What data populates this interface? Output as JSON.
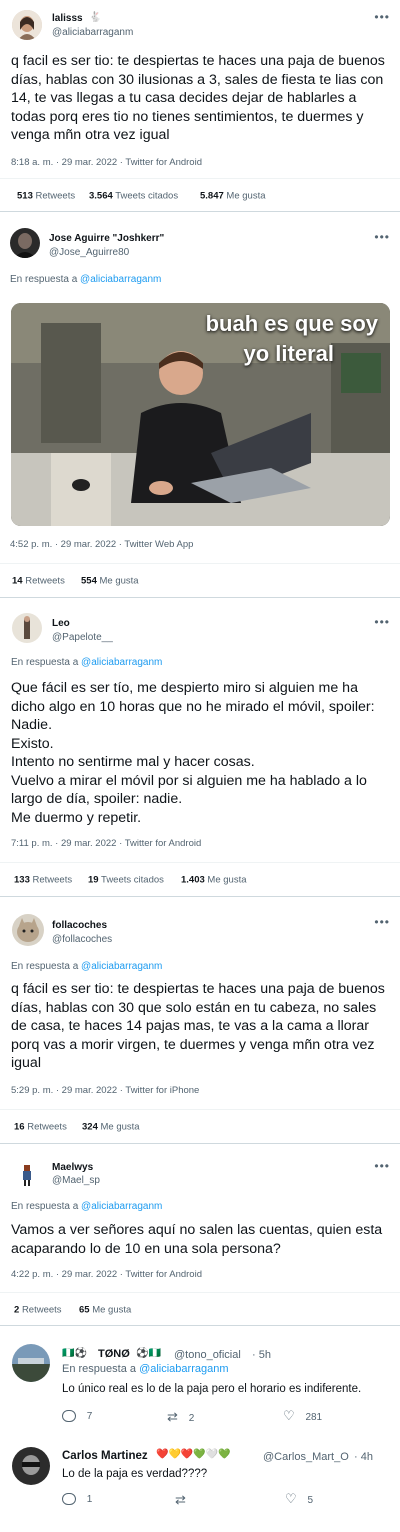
{
  "tweets": [
    {
      "name": "lalisss",
      "handle": "@aliciabarraganm",
      "text": "q facil es ser tio: te despiertas te haces una paja de buenos días, hablas con 30 ilusionas a 3, sales de fiesta te lias con 14, te vas llegas a tu casa decides dejar de hablarles a todas porq eres tio no tienes sentimientos, te duermes y venga mñn otra vez igual",
      "meta": "8:18 a. m. · 29 mar. 2022 · Twitter for Android",
      "retweets": "513",
      "retweets_label": "Retweets",
      "quotes": "3.564",
      "quotes_label": "Tweets citados",
      "likes": "5.847",
      "likes_label": "Me gusta"
    },
    {
      "name": "Jose Aguirre \"Joshkerr\"",
      "handle": "@Jose_Aguirre80",
      "reply_prefix": "En respuesta a",
      "reply_to": "@aliciabarraganm",
      "image_caption_1": "buah es que soy",
      "image_caption_2": "yo literal",
      "meta": "4:52 p. m. · 29 mar. 2022 · Twitter Web App",
      "retweets": "14",
      "retweets_label": "Retweets",
      "likes": "554",
      "likes_label": "Me gusta"
    },
    {
      "name": "Leo",
      "handle": "@Papelote__",
      "reply_prefix": "En respuesta a",
      "reply_to": "@aliciabarraganm",
      "text": "Que fácil es ser tío, me despierto miro si alguien me ha dicho algo en 10 horas que no he mirado el móvil, spoiler: Nadie.\nExisto.\nIntento no sentirme mal y hacer cosas.\nVuelvo a mirar el móvil por si alguien me ha hablado a lo largo de día, spoiler: nadie.\nMe duermo y repetir.",
      "meta": "7:11 p. m. · 29 mar. 2022 · Twitter for Android",
      "retweets": "133",
      "retweets_label": "Retweets",
      "quotes": "19",
      "quotes_label": "Tweets citados",
      "likes": "1.403",
      "likes_label": "Me gusta"
    },
    {
      "name": "follacoches",
      "handle": "@follacoches",
      "reply_prefix": "En respuesta a",
      "reply_to": "@aliciabarraganm",
      "text": "q fácil es ser tio: te despiertas te haces una paja de buenos días, hablas con 30 que solo están en tu cabeza, no sales de casa, te haces 14 pajas mas, te vas a la cama a llorar porq vas a morir virgen, te duermes y venga mñn otra vez igual",
      "meta": "5:29 p. m. · 29 mar. 2022 · Twitter for iPhone",
      "retweets": "16",
      "retweets_label": "Retweets",
      "likes": "324",
      "likes_label": "Me gusta"
    },
    {
      "name": "Maelwys",
      "handle": "@Mael_sp",
      "reply_prefix": "En respuesta a",
      "reply_to": "@aliciabarraganm",
      "text": "Vamos a ver señores aquí no salen las cuentas, quien esta acaparando lo de 10 en una sola persona?",
      "meta": "4:22 p. m. · 29 mar. 2022 · Twitter for Android",
      "retweets": "2",
      "retweets_label": "Retweets",
      "likes": "65",
      "likes_label": "Me gusta"
    }
  ],
  "replies": [
    {
      "name": "TØNØ",
      "handle": "@tono_oficial",
      "time": "· 5h",
      "reply_prefix": "En respuesta a",
      "reply_to": "@aliciabarraganm",
      "text": "Lo único real es lo de la paja pero el horario es indiferente.",
      "reply_count": "7",
      "retweet_count": "2",
      "like_count": "281"
    },
    {
      "name": "Carlos Martinez",
      "handle": "@Carlos_Mart_O",
      "time": "· 4h",
      "text": "Lo de la paja es verdad????",
      "reply_count": "1",
      "retweet_count": "",
      "like_count": "5"
    }
  ],
  "icons": {
    "more": "more-icon",
    "reply": "reply-icon",
    "retweet": "retweet-icon",
    "like": "heart-icon",
    "verified": "verified-icon"
  },
  "colors": {
    "link": "#1d9bf0",
    "secondary": "#536471"
  }
}
